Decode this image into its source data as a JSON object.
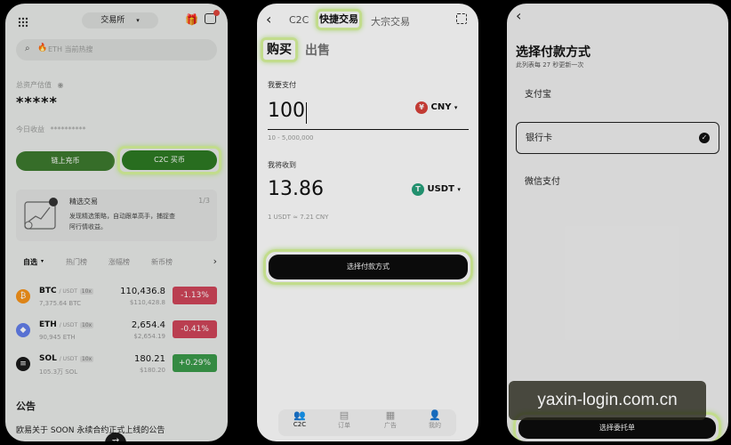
{
  "screen1": {
    "header_title": "交易所",
    "search_placeholder": "ETH 当前热搜",
    "asset_label": "总资产估值",
    "asset_hidden": "*****",
    "profit_label": "今日收益",
    "profit_hidden": "**********",
    "btn_chain": "链上充币",
    "btn_c2c": "C2C 买币",
    "card_title": "精选交易",
    "card_counter": "1/3",
    "card_desc": "发现精选策略，自动跟单高手，捕捉查阿行情收益。",
    "tabs": [
      "自选",
      "热门榜",
      "涨幅榜",
      "新币榜"
    ],
    "coins": [
      {
        "sym": "BTC",
        "pair": "/ USDT",
        "lev": "10x",
        "vol": "7,375.64 BTC",
        "price": "110,436.8",
        "sub": "$110,428.8",
        "chg": "-1.13%",
        "color": "#f7931a",
        "glyph": "₿",
        "up": false
      },
      {
        "sym": "ETH",
        "pair": "/ USDT",
        "lev": "10x",
        "vol": "90,945 ETH",
        "price": "2,654.4",
        "sub": "$2,654.19",
        "chg": "-0.41%",
        "color": "#627eea",
        "glyph": "◆",
        "up": false
      },
      {
        "sym": "SOL",
        "pair": "/ USDT",
        "lev": "10x",
        "vol": "105.3万 SOL",
        "price": "180.21",
        "sub": "$180.20",
        "chg": "+0.29%",
        "color": "#1a1a1a",
        "glyph": "≡",
        "up": true
      }
    ],
    "announce_title": "公告",
    "announce_text": "欧易关于 SOON 永续合约正式上线的公告"
  },
  "screen2": {
    "tab_c2c": "C2C",
    "tab_quick": "快捷交易",
    "tab_bulk": "大宗交易",
    "tab_buy": "购买",
    "tab_sell": "出售",
    "pay_label": "我要支付",
    "pay_amount": "100",
    "pay_currency": "CNY",
    "pay_range": "10 - 5,000,000",
    "receive_label": "我将收到",
    "receive_amount": "13.86",
    "receive_currency": "USDT",
    "rate": "1 USDT ≈ 7.21 CNY",
    "cta": "选择付款方式",
    "nav": [
      "C2C",
      "订单",
      "广告",
      "我的"
    ]
  },
  "screen3": {
    "title": "选择付款方式",
    "subtitle": "此列表每 27 秒更新一次",
    "options": [
      "支付宝",
      "银行卡",
      "微信支付"
    ],
    "selected": 1,
    "cta": "选择委托单"
  },
  "watermark": "yaxin-login.com.cn"
}
